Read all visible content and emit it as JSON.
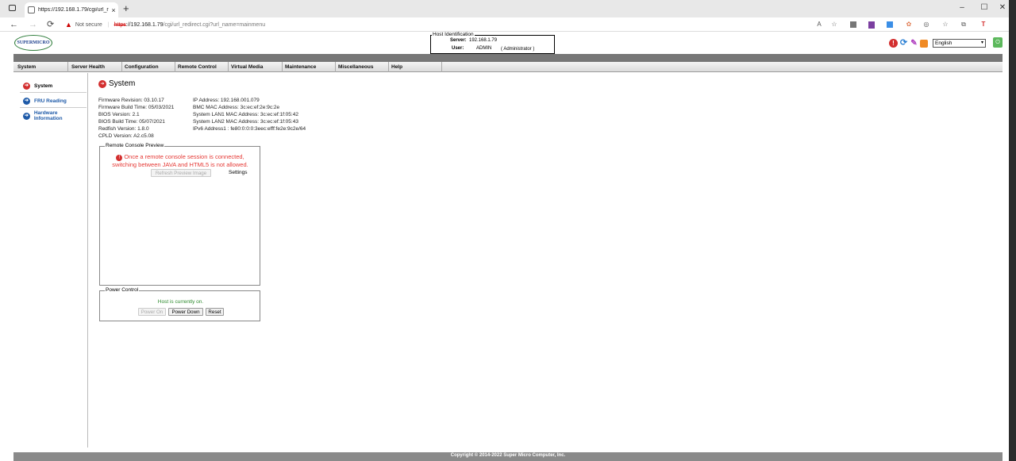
{
  "browser": {
    "tab_title": "https://192.168.1.79/cgi/url_redi",
    "close_glyph": "×",
    "newtab_glyph": "+",
    "minimize_glyph": "–",
    "maximize_glyph": "☐",
    "close_window_glyph": "✕",
    "back_glyph": "←",
    "forward_glyph": "→",
    "reload_glyph": "⟳",
    "warning_glyph": "▲",
    "not_secure": "Not secure",
    "separator": "|",
    "url_scheme": "https",
    "url_host": "://192.168.1.79",
    "url_path": "/cgi/url_redirect.cgi?url_name=mainmenu",
    "toolbar_icons": [
      "read-aloud-icon",
      "favorite-add-icon",
      "wallet-icon",
      "onenote-icon",
      "extension-icon",
      "palette-icon",
      "copilot-icon",
      "favorites-icon",
      "collections-icon",
      "pen-icon"
    ]
  },
  "header": {
    "logo_text": "SUPERMICRO",
    "host_legend": "Host Identification",
    "server_label": "Server:",
    "server_value": "192.168.1.79",
    "user_label": "User:",
    "user_value": "ADMIN",
    "user_role": "( Administrator )",
    "language": "English",
    "alert_glyph": "!",
    "refresh_glyph": "⟳",
    "logout_glyph": "⏻",
    "select_arrow": "▾"
  },
  "menu": [
    "System",
    "Server Health",
    "Configuration",
    "Remote Control",
    "Virtual Media",
    "Maintenance",
    "Miscellaneous",
    "Help"
  ],
  "sidebar": {
    "items": [
      {
        "label": "System",
        "active": true
      },
      {
        "label": "FRU Reading",
        "active": false
      },
      {
        "label": "Hardware Information",
        "active": false
      }
    ],
    "arrow_glyph": "➔"
  },
  "main": {
    "title": "System",
    "left_info": [
      "Firmware Revision: 03.10.17",
      "Firmware Build Time: 05/03/2021",
      "BIOS Version: 2.1",
      "BIOS Build Time: 05/07/2021",
      "Redfish Version: 1.8.0",
      "CPLD Version: A2.c5.08"
    ],
    "right_info": [
      "IP Address: 192.168.001.079",
      "BMC MAC Address: 3c:ec:ef:2e:9c:2e",
      "System LAN1 MAC Address: 3c:ec:ef:1f:05:42",
      "System LAN2 MAC Address: 3c:ec:ef:1f:05:43",
      "IPv6 Address1 : fe80:0:0:0:3eec:efff:fe2e:9c2e/64"
    ],
    "console": {
      "legend": "Remote Console Preview",
      "error_icon_glyph": "!",
      "error_line1": "Once a remote console session is connected,",
      "error_line2": "switching between JAVA and HTML5 is not allowed.",
      "refresh_button": "Refresh Preview Image",
      "settings_link": "Settings"
    },
    "power": {
      "legend": "Power Control",
      "status": "Host is currently on.",
      "power_on": "Power On",
      "power_down": "Power Down",
      "reset": "Reset"
    }
  },
  "footer": {
    "copyright": "Copyright © 2014-2022 Super Micro Computer, Inc."
  },
  "colors": {
    "accent_red": "#e53935",
    "link_blue": "#1e5aa8",
    "status_green": "#2e8b2e"
  }
}
